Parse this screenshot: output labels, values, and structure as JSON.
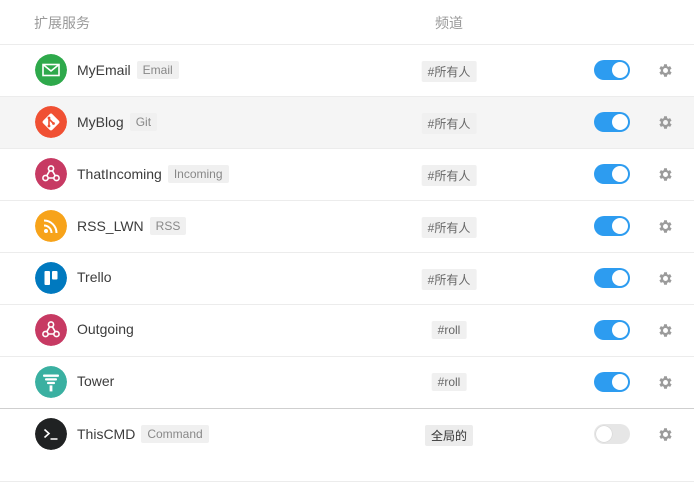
{
  "header": {
    "col_name": "扩展服务",
    "col_channel": "频道"
  },
  "rows": [
    {
      "name": "MyEmail",
      "tag": "Email",
      "channel": "#所有人",
      "enabled": true,
      "icon": "email-icon",
      "color": "#2ea94b"
    },
    {
      "name": "MyBlog",
      "tag": "Git",
      "channel": "#所有人",
      "enabled": true,
      "icon": "git-icon",
      "color": "#f05033"
    },
    {
      "name": "ThatIncoming",
      "tag": "Incoming",
      "channel": "#所有人",
      "enabled": true,
      "icon": "webhook-icon",
      "color": "#c73a63"
    },
    {
      "name": "RSS_LWN",
      "tag": "RSS",
      "channel": "#所有人",
      "enabled": true,
      "icon": "rss-icon",
      "color": "#f7a31a"
    },
    {
      "name": "Trello",
      "tag": "",
      "channel": "#所有人",
      "enabled": true,
      "icon": "trello-icon",
      "color": "#0079bf"
    },
    {
      "name": "Outgoing",
      "tag": "",
      "channel": "#roll",
      "enabled": true,
      "icon": "webhook-icon",
      "color": "#c73a63"
    },
    {
      "name": "Tower",
      "tag": "",
      "channel": "#roll",
      "enabled": true,
      "icon": "tower-icon",
      "color": "#3ab0a1"
    },
    {
      "name": "ThisCMD",
      "tag": "Command",
      "channel": "全局的",
      "enabled": false,
      "icon": "terminal-icon",
      "color": "#202223"
    }
  ],
  "colors": {
    "toggle_on": "#2d9cf0",
    "toggle_off": "#e6e6e6",
    "gear": "#9b9b9b"
  }
}
